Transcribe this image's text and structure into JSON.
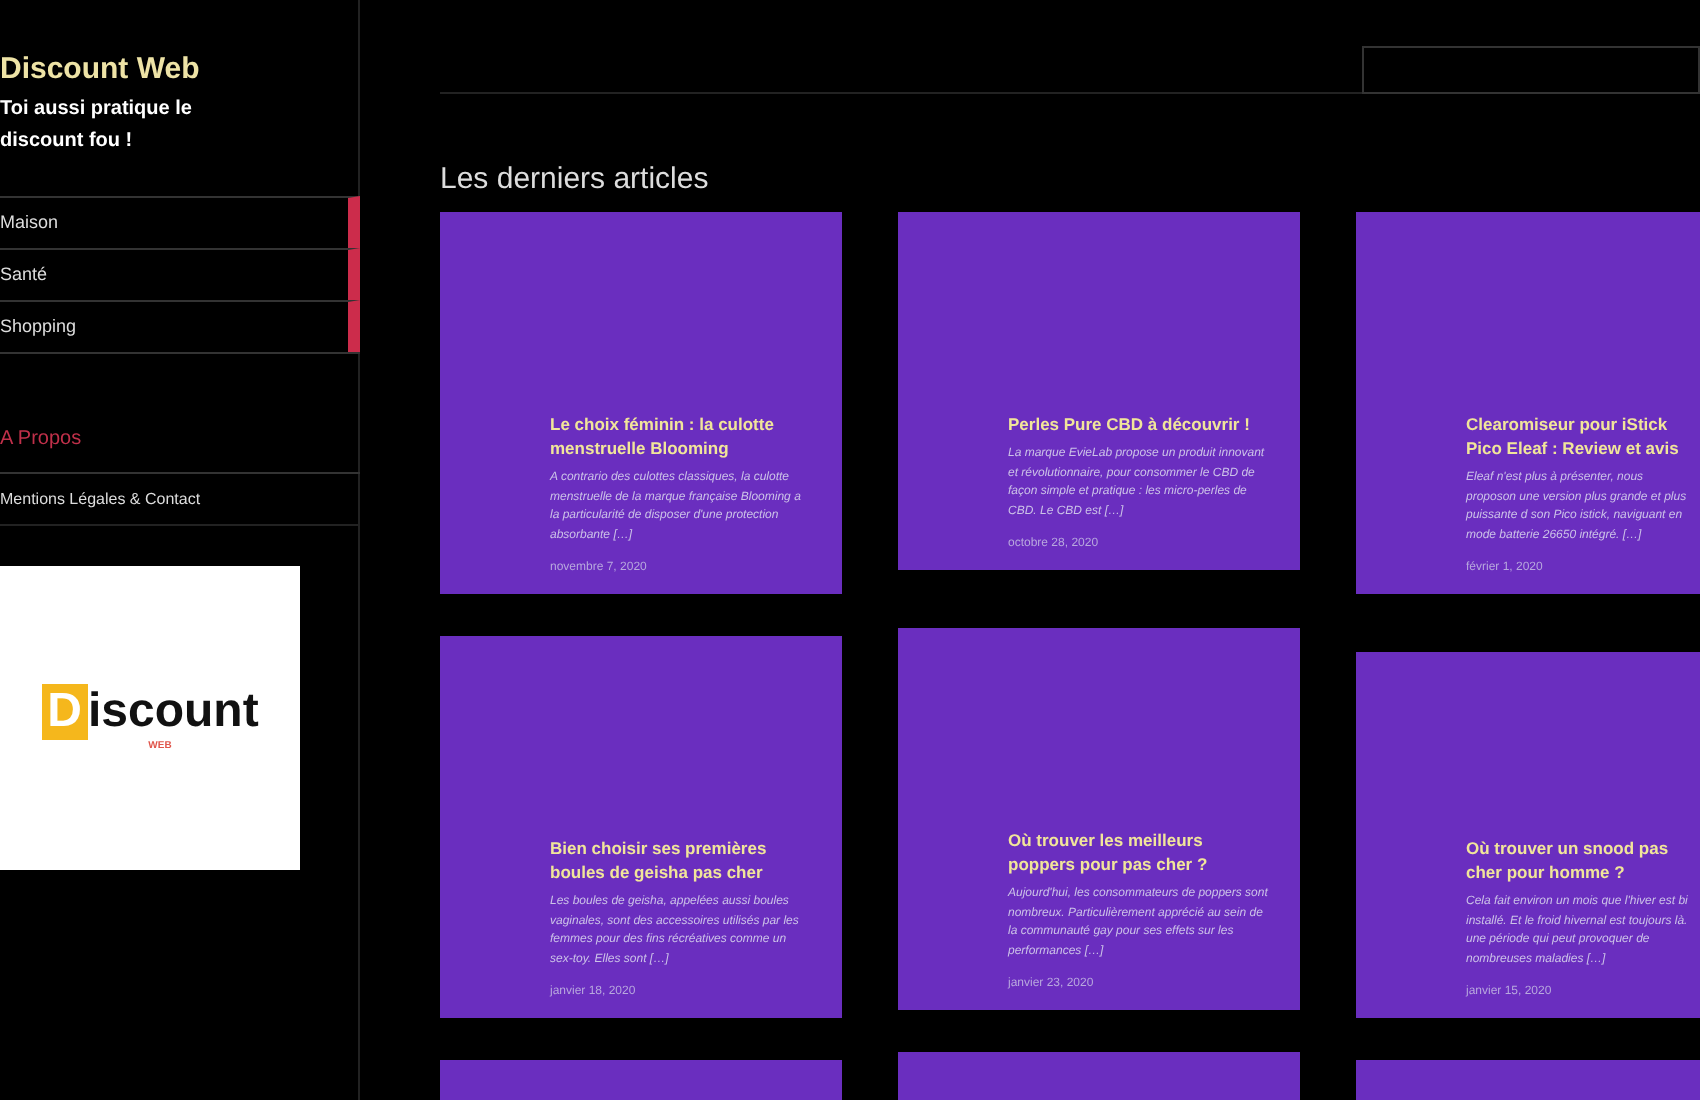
{
  "site": {
    "title": "Discount Web",
    "tagline": "Toi aussi pratique le discount fou !"
  },
  "menu": [
    {
      "label": "Maison",
      "kind": "primary"
    },
    {
      "label": "Santé",
      "kind": "primary"
    },
    {
      "label": "Shopping",
      "kind": "primary"
    },
    {
      "label": "A Propos",
      "kind": "accent"
    },
    {
      "label": "Mentions Légales & Contact",
      "kind": "secondary"
    }
  ],
  "logo": {
    "text": "iscount",
    "initial": "D",
    "sub": "WEB"
  },
  "section_title": "Les derniers articles",
  "columns": [
    {
      "articles": [
        {
          "title": "Le choix féminin : la culotte menstruelle Blooming",
          "excerpt": "A contrario des culottes classiques, la culotte menstruelle de la marque française Blooming a la particularité de disposer d'une protection absorbante […]",
          "date": "novembre 7, 2020"
        },
        {
          "title": "Bien choisir ses premières boules de geisha pas cher",
          "excerpt": "Les boules de geisha, appelées aussi boules vaginales, sont des accessoires utilisés par les femmes pour des fins récréatives comme un sex-toy. Elles sont […]",
          "date": "janvier 18, 2020"
        }
      ]
    },
    {
      "articles": [
        {
          "title": "Perles Pure CBD à découvrir !",
          "excerpt": "La marque EvieLab propose un produit innovant et révolutionnaire, pour consommer le CBD de façon simple et pratique : les micro-perles de CBD. Le CBD est […]",
          "date": "octobre 28, 2020"
        },
        {
          "title": "Où trouver les meilleurs poppers pour pas cher ?",
          "excerpt": "Aujourd'hui, les consommateurs de poppers sont nombreux. Particulièrement apprécié au sein de la communauté gay pour ses effets sur les performances […]",
          "date": "janvier 23, 2020"
        }
      ]
    },
    {
      "articles": [
        {
          "title": "Clearomiseur pour iStick Pico Eleaf : Review et avis",
          "excerpt": "Eleaf n'est plus à présenter, nous proposon une version plus grande et plus puissante d son Pico istick, naviguant en mode batterie 26650 intégré. […]",
          "date": "février 1, 2020"
        },
        {
          "title": "Où trouver un snood pas cher pour homme ?",
          "excerpt": "Cela fait environ un mois que l'hiver est bi installé. Et le froid hivernal est toujours là. une période qui peut provoquer de nombreuses maladies […]",
          "date": "janvier 15, 2020"
        }
      ]
    }
  ]
}
